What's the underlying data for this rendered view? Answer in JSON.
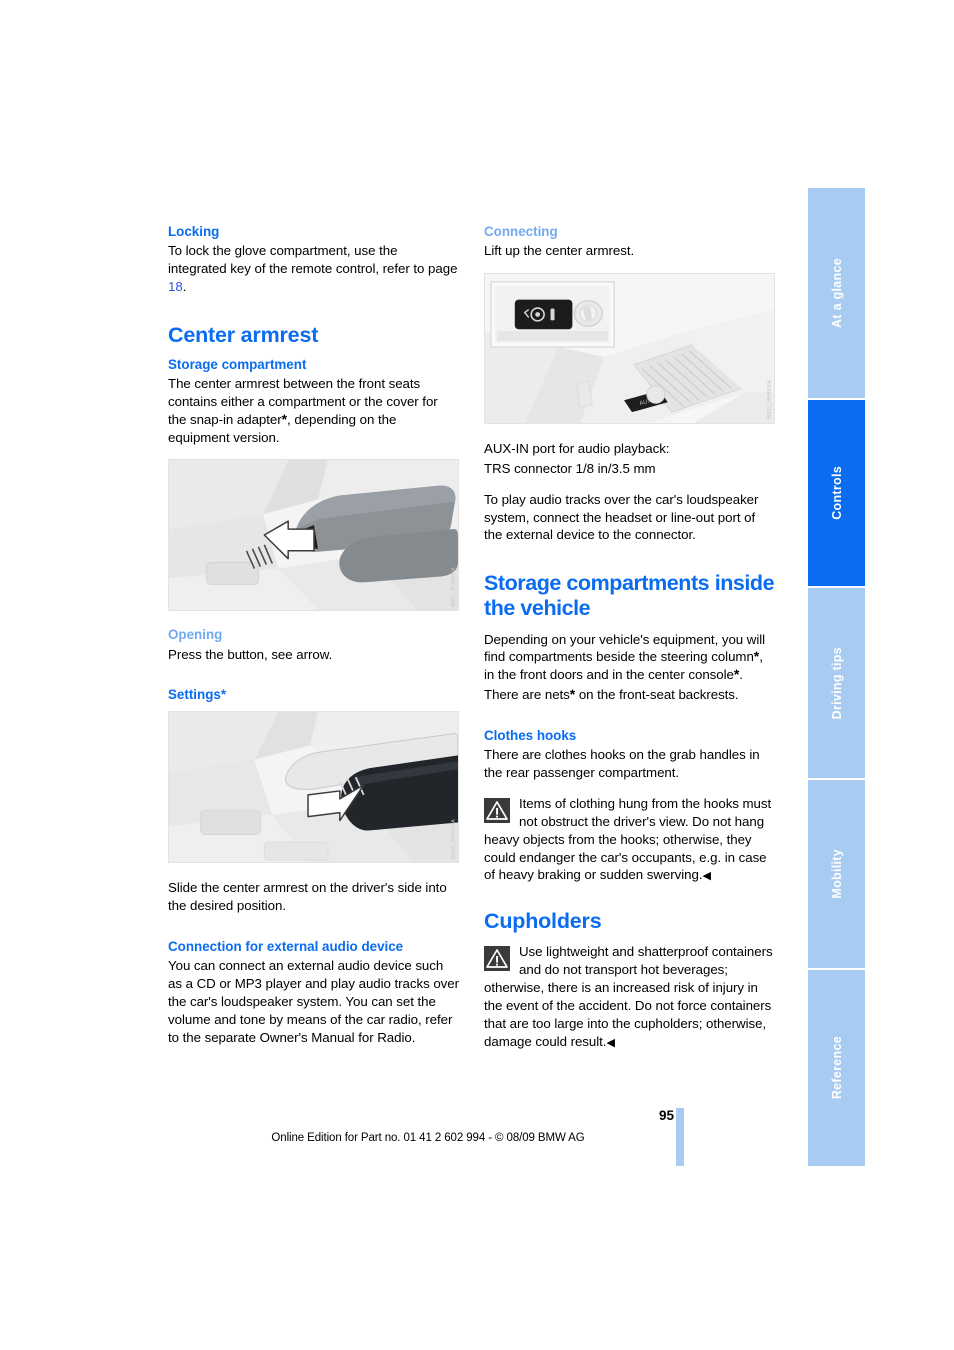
{
  "document": {
    "page_number": "95",
    "footer": "Online Edition for Part no. 01 41 2 602 994 - © 08/09 BMW AG"
  },
  "tabs": [
    {
      "label": "At a glance",
      "active": false
    },
    {
      "label": "Controls",
      "active": true
    },
    {
      "label": "Driving tips",
      "active": false
    },
    {
      "label": "Mobility",
      "active": false
    },
    {
      "label": "Reference",
      "active": false
    }
  ],
  "left_column": {
    "locking": {
      "heading": "Locking",
      "text_before": "To lock the glove compartment, use the integrated key of the remote control, refer to page ",
      "page_ref": "18",
      "text_after": "."
    },
    "center_armrest": {
      "heading": "Center armrest",
      "storage": {
        "heading": "Storage compartment",
        "text_a": "The center armrest between the front seats contains either a compartment or the cover for the snap-in adapter",
        "text_b": ", depending on the equipment version."
      },
      "figure_armrest": {
        "code": "WKO_PORVHA"
      },
      "opening": {
        "heading": "Opening",
        "text": "Press the button, see arrow."
      },
      "settings": {
        "heading": "Settings*"
      },
      "figure_settings": {
        "code": "WKO_PORVHA"
      },
      "settings_text": "Slide the center armrest on the driver's side into the desired position."
    },
    "external_audio": {
      "heading": "Connection for external audio device",
      "text": "You can connect an external audio device such as a CD or MP3 player and play audio tracks over the car's loudspeaker system. You can set the volume and tone by means of the car radio, refer to the separate Owner's Manual for Radio."
    }
  },
  "right_column": {
    "connecting": {
      "heading": "Connecting",
      "text": "Lift up the center armrest."
    },
    "figure_aux": {
      "code": "WKO_HHAVKA"
    },
    "aux_info_line1": "AUX-IN port for audio playback:",
    "aux_info_line2": "TRS connector 1/8 in/3.5 mm",
    "aux_play_text": "To play audio tracks over the car's loudspeaker system, connect the headset or line-out port of the external device to the connector.",
    "storage_inside": {
      "heading": "Storage compartments inside the vehicle",
      "text_a": "Depending on your vehicle's equipment, you will find compartments beside the steering column",
      "text_b": ", in the front doors and in the center console",
      "text_c": ".",
      "text_d": "There are nets",
      "text_e": " on the front-seat backrests."
    },
    "clothes_hooks": {
      "heading": "Clothes hooks",
      "text": "There are clothes hooks on the grab handles in the rear passenger compartment.",
      "warning": "Items of clothing hung from the hooks must not obstruct the driver's view. Do not hang heavy objects from the hooks; otherwise, they could endanger the car's occupants, e.g. in case of heavy braking or sudden swerving.",
      "warning_endmark": "◀"
    },
    "cupholders": {
      "heading": "Cupholders",
      "warning": "Use lightweight and shatterproof containers and do not transport hot beverages; otherwise, there is an increased risk of injury in the event of the accident. Do not force containers that are too large into the cupholders; otherwise, damage could result.",
      "warning_endmark": "◀"
    }
  },
  "symbols": {
    "asterisk": "*"
  },
  "colors": {
    "heading_blue": "#0a6cf0",
    "subheading_soft_blue": "#72aaf0",
    "tab_inactive": "#a8cbf2",
    "tab_active": "#0a6cf0",
    "page_link": "#3a52e8"
  }
}
